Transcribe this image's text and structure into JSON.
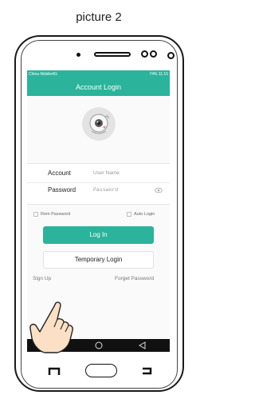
{
  "caption": "picture 2",
  "status_bar": {
    "carrier": "China Mobile4G",
    "right_info": "74%  11:15"
  },
  "app_bar": {
    "title": "Account Login"
  },
  "form": {
    "account_label": "Account",
    "account_placeholder": "User Name",
    "password_label": "Password",
    "password_placeholder": "Password"
  },
  "options": {
    "remember_password": "Rem Password",
    "auto_login": "Auto Login"
  },
  "buttons": {
    "login": "Log In",
    "temporary_login": "Temporary Login"
  },
  "links": {
    "sign_up": "Sign Up",
    "forget_password": "Forget Password"
  },
  "colors": {
    "accent": "#2bb39b",
    "navbar": "#111111"
  },
  "icons": {
    "eye": "eye-icon",
    "back": "back-icon",
    "home": "home-icon",
    "recents": "recents-icon",
    "hand": "pointing-hand-icon",
    "avatar": "camera-robot-avatar"
  }
}
